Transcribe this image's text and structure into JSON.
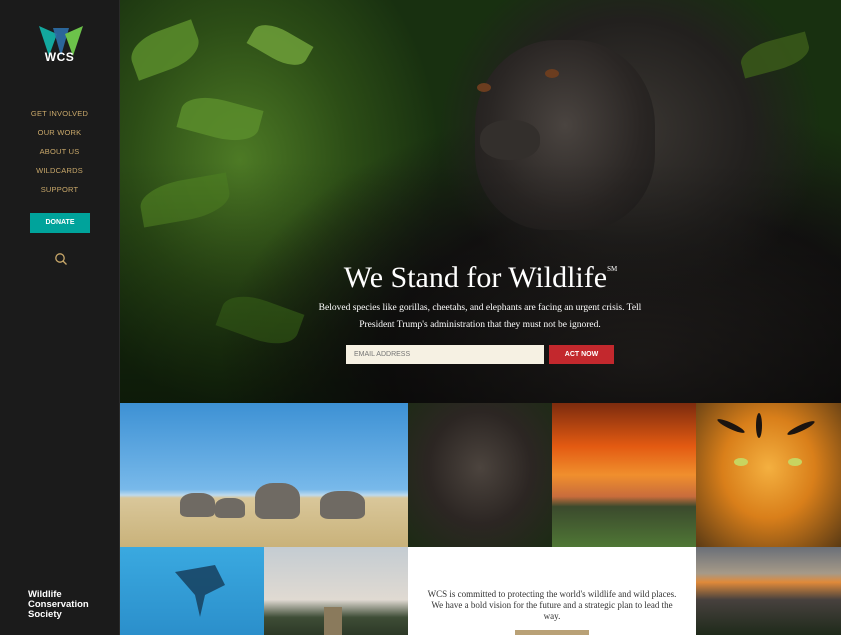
{
  "brand": {
    "logo_text": "WCS",
    "footer_text": "Wildlife\nConservation\nSociety"
  },
  "nav": {
    "items": [
      "GET INVOLVED",
      "OUR WORK",
      "ABOUT US",
      "WILDCARDS",
      "SUPPORT"
    ],
    "donate": "DONATE"
  },
  "hero": {
    "title": "We Stand for Wildlife",
    "title_mark": "SM",
    "subtitle": "Beloved species like gorillas, cheetahs, and elephants are facing an urgent crisis. Tell President Trump's administration that they must not be ignored.",
    "email_placeholder": "EMAIL ADDRESS",
    "cta": "ACT NOW"
  },
  "mission": {
    "text": "WCS is committed to protecting the world's wildlife and wild places. We have a bold vision for the future and a strategic plan to lead the way."
  },
  "colors": {
    "accent": "#00a39b",
    "nav_gold": "#c9a86a",
    "cta_red": "#c3282d"
  },
  "icons": {
    "search": "search-icon",
    "logo": "wcs-logo-icon"
  }
}
